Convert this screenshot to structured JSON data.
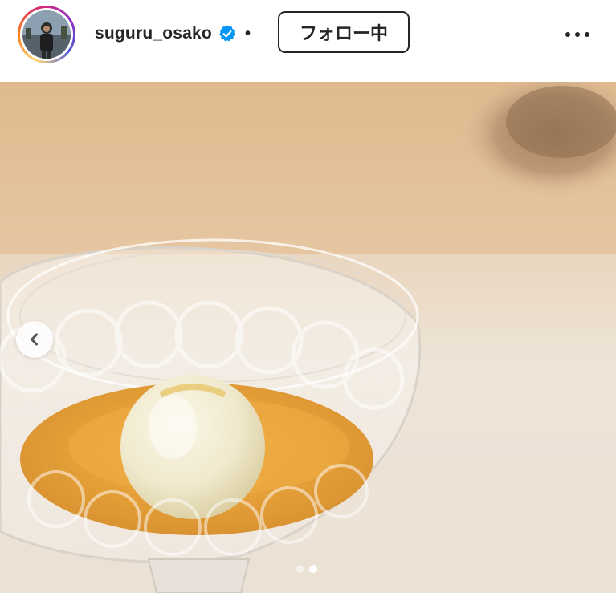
{
  "post_header": {
    "username": "suguru_osako",
    "verified": true,
    "separator": "•",
    "follow_button_label": "フォロー中",
    "more_icon": "more-horizontal-icon"
  },
  "media": {
    "description_icon": "carousel-photo",
    "prev_icon": "chevron-left-icon",
    "carousel": {
      "slide_count": 2,
      "active_index": 2
    }
  },
  "colors": {
    "text": "#262626",
    "verified_badge": "#0095f6",
    "background": "#ffffff"
  }
}
